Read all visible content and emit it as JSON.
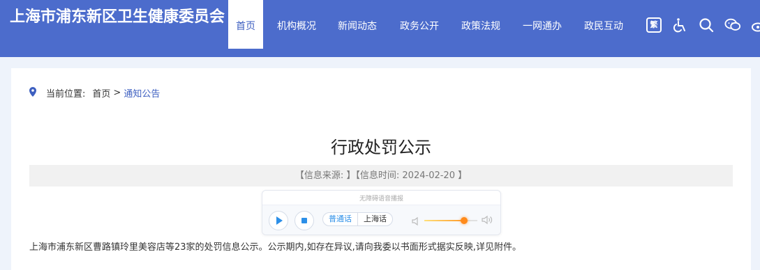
{
  "header": {
    "site_title": "上海市浦东新区卫生健康委员会",
    "nav": [
      {
        "label": "首页",
        "active": true
      },
      {
        "label": "机构概况"
      },
      {
        "label": "新闻动态"
      },
      {
        "label": "政务公开"
      },
      {
        "label": "政策法规"
      },
      {
        "label": "一网通办"
      },
      {
        "label": "政民互动"
      }
    ],
    "tools": {
      "traditional_char": "繁",
      "icons": [
        "traditional-chinese-icon",
        "accessibility-icon",
        "search-icon",
        "wechat-icon",
        "weibo-icon"
      ]
    },
    "colors": {
      "brand": "#4c6ccc",
      "link": "#3d5fc0"
    }
  },
  "breadcrumb": {
    "label": "当前位置:",
    "home": "首页",
    "separator": ">",
    "current": "通知公告"
  },
  "article": {
    "title": "行政处罚公示",
    "meta": "【信息来源: 】【信息时间: 2024-02-20 】",
    "body": "上海市浦东新区曹路镇玲里美容店等23家的处罚信息公示。公示期内,如存在异议,请向我委以书面形式据实反映,详见附件。"
  },
  "player": {
    "label": "无障碍语音播报",
    "dialects": [
      "普通话",
      "上海话"
    ],
    "selected_dialect": "普通话",
    "volume": 0.75
  }
}
